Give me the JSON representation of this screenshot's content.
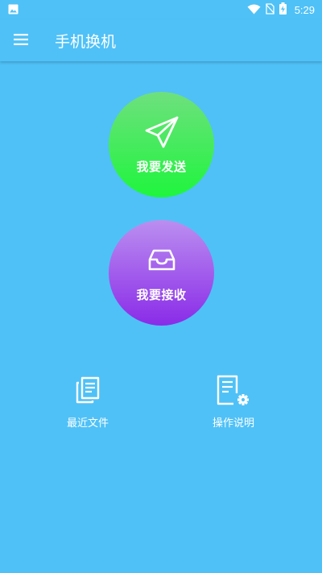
{
  "status_bar": {
    "time": "5:29",
    "icons": [
      "image-notification-icon",
      "wifi-icon",
      "no-sim-icon",
      "battery-charging-icon"
    ]
  },
  "toolbar": {
    "title": "手机换机",
    "menu_icon": "hamburger-menu-icon"
  },
  "actions": {
    "send": {
      "label": "我要发送",
      "icon": "paper-plane-icon"
    },
    "receive": {
      "label": "我要接收",
      "icon": "inbox-tray-icon"
    }
  },
  "shortcuts": {
    "recent_files": {
      "label": "最近文件",
      "icon": "documents-copy-icon"
    },
    "instructions": {
      "label": "操作说明",
      "icon": "document-settings-icon"
    }
  },
  "colors": {
    "background": "#4fc1f7",
    "send_gradient_top": "#6ee07e",
    "send_gradient_bottom": "#1ff53d",
    "receive_gradient_top": "#bb8ff0",
    "receive_gradient_bottom": "#8a2be8"
  }
}
